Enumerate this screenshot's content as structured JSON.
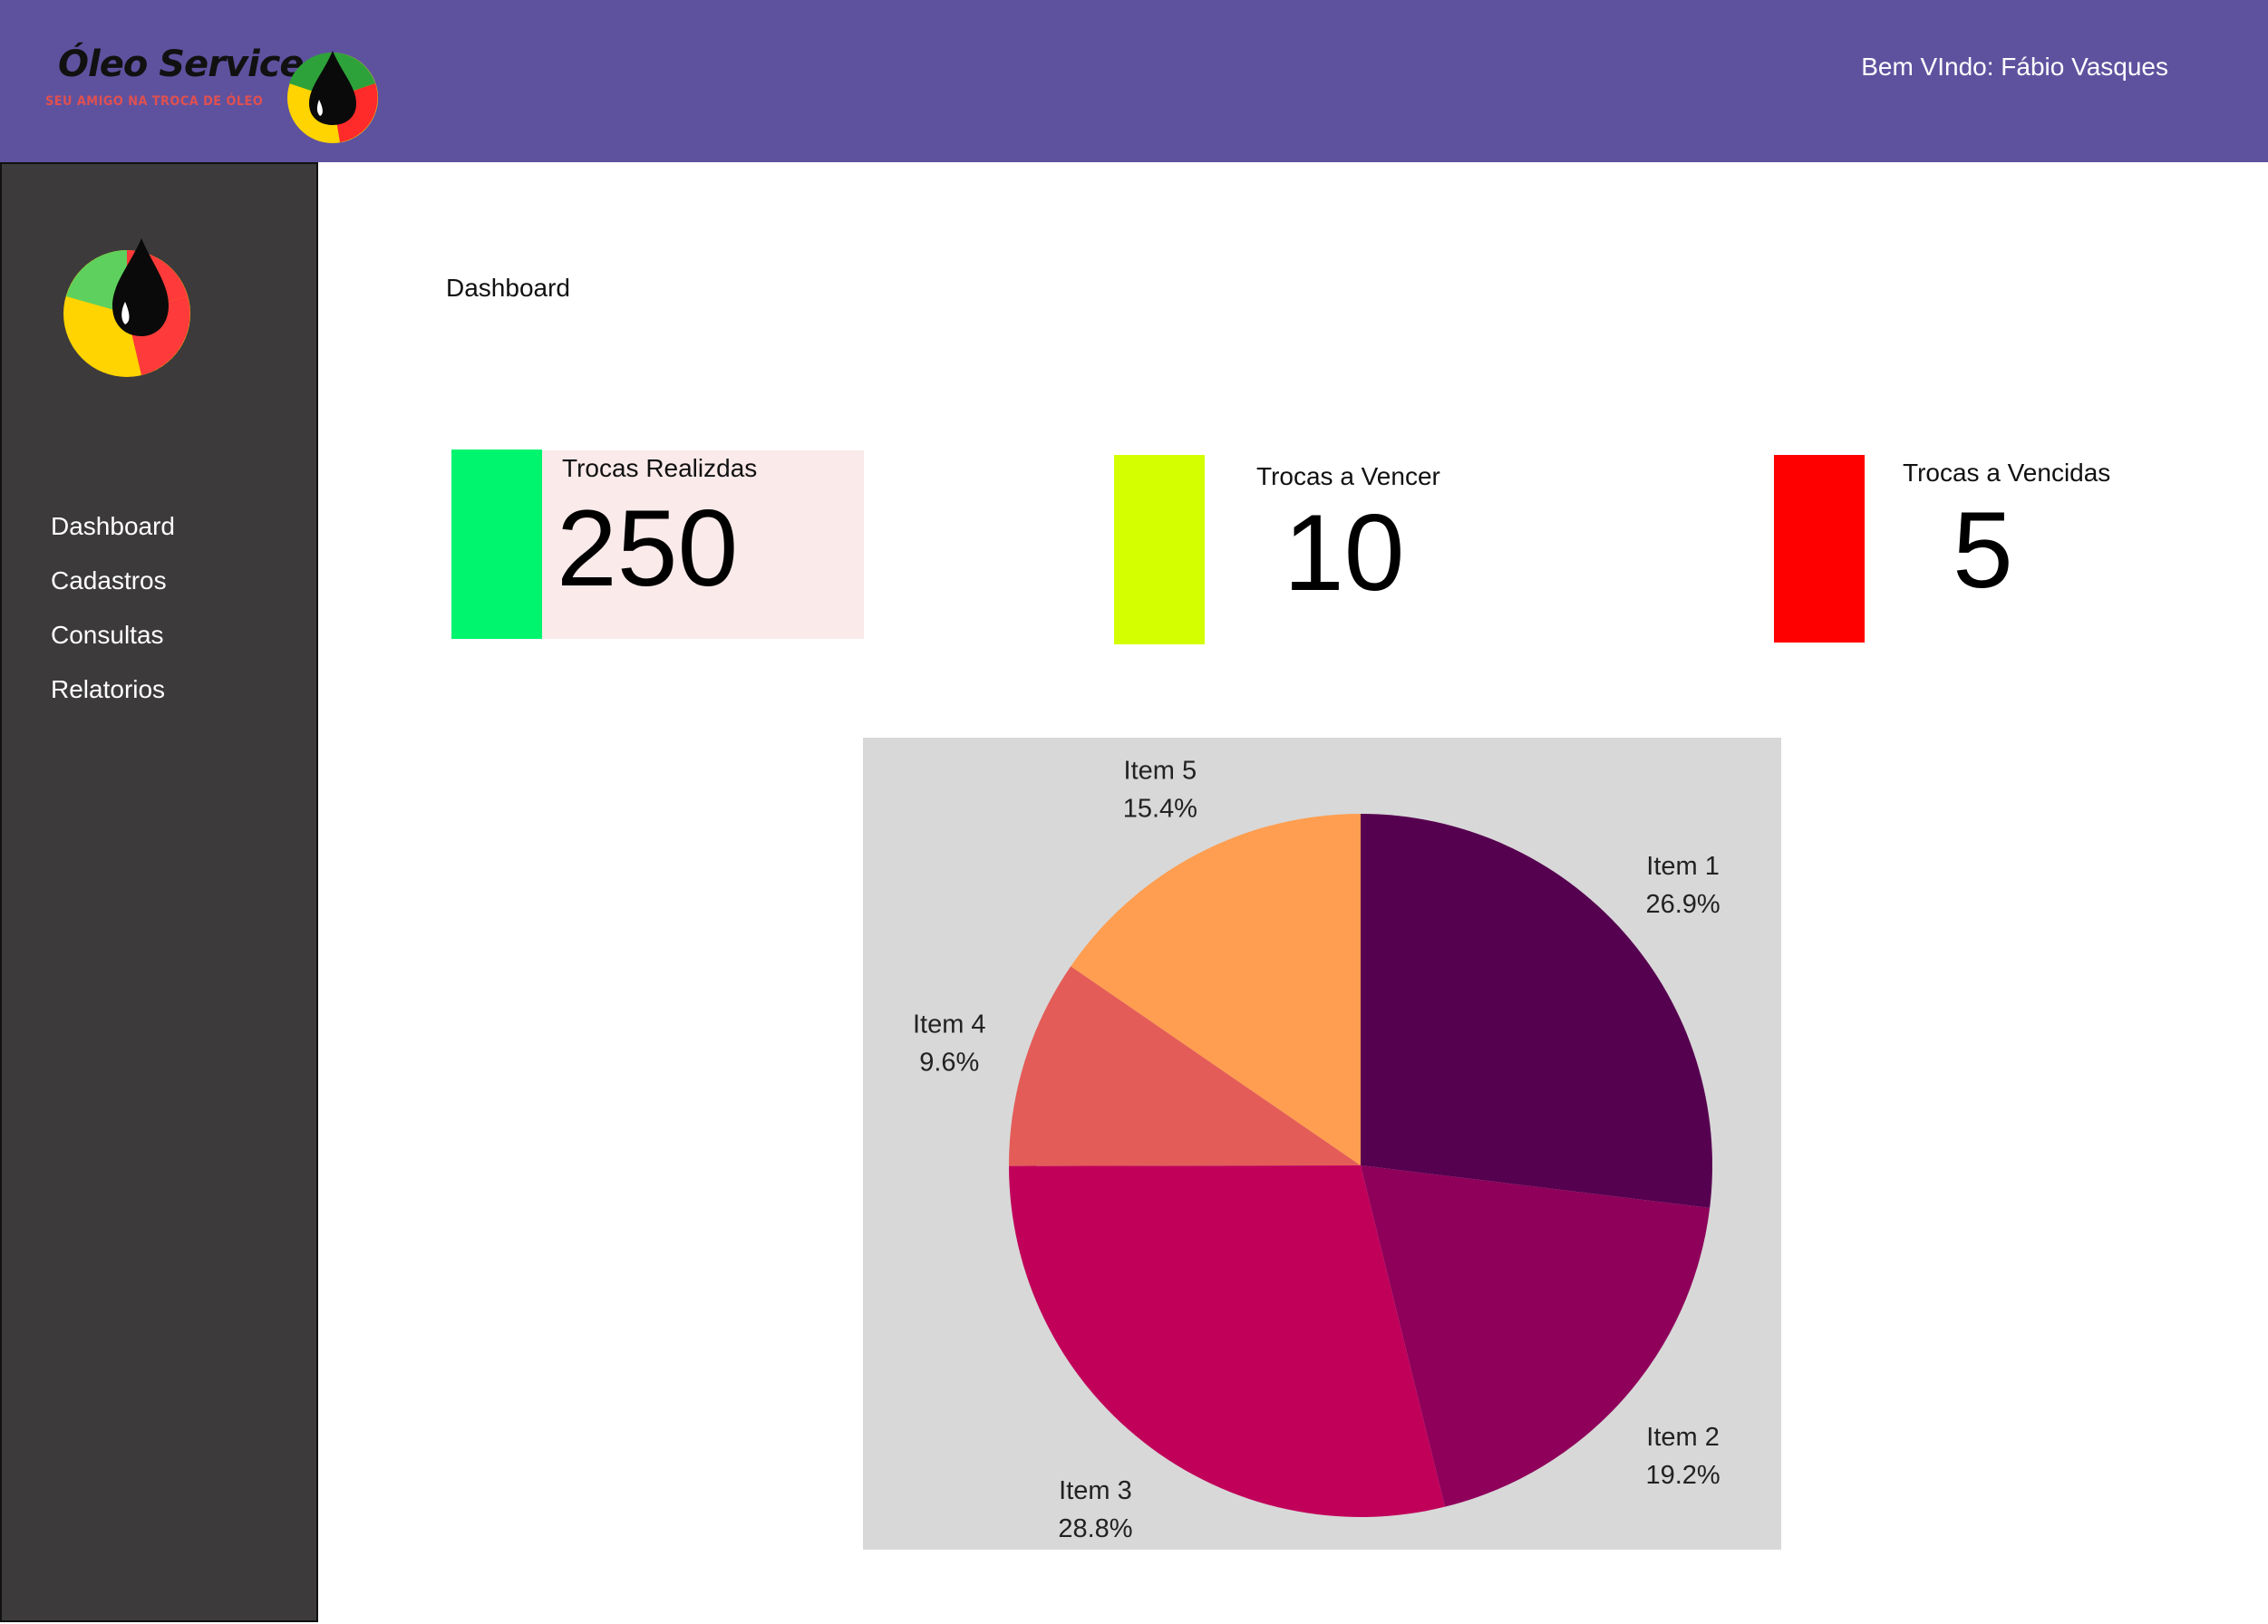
{
  "header": {
    "brand_name": "Óleo Service",
    "brand_tagline": "SEU AMIGO NA TROCA DE ÓLEO",
    "welcome": "Bem VIndo: Fábio Vasques",
    "background_color": "#5e529f"
  },
  "sidebar": {
    "background_color": "#3c3a3b",
    "items": [
      {
        "label": "Dashboard"
      },
      {
        "label": "Cadastros"
      },
      {
        "label": "Consultas"
      },
      {
        "label": "Relatorios"
      }
    ]
  },
  "main": {
    "title": "Dashboard",
    "cards": [
      {
        "label": "Trocas Realizdas",
        "value": "250",
        "color": "#00f56f"
      },
      {
        "label": "Trocas a Vencer",
        "value": "10",
        "color": "#d4ff00"
      },
      {
        "label": "Trocas a Vencidas",
        "value": "5",
        "color": "#ff0000"
      }
    ]
  },
  "chart_data": {
    "type": "pie",
    "slices": [
      {
        "label": "Item 1",
        "percent": 26.9,
        "percent_label": "26.9%",
        "color": "#560050"
      },
      {
        "label": "Item 2",
        "percent": 19.2,
        "percent_label": "19.2%",
        "color": "#8e005a"
      },
      {
        "label": "Item 3",
        "percent": 28.8,
        "percent_label": "28.8%",
        "color": "#c1005a"
      },
      {
        "label": "Item 4",
        "percent": 9.6,
        "percent_label": "9.6%",
        "color": "#e45c58"
      },
      {
        "label": "Item 5",
        "percent": 15.4,
        "percent_label": "15.4%",
        "color": "#ff9e50"
      }
    ],
    "start": "top",
    "direction": "clockwise",
    "background_color": "#d8d8d8"
  }
}
